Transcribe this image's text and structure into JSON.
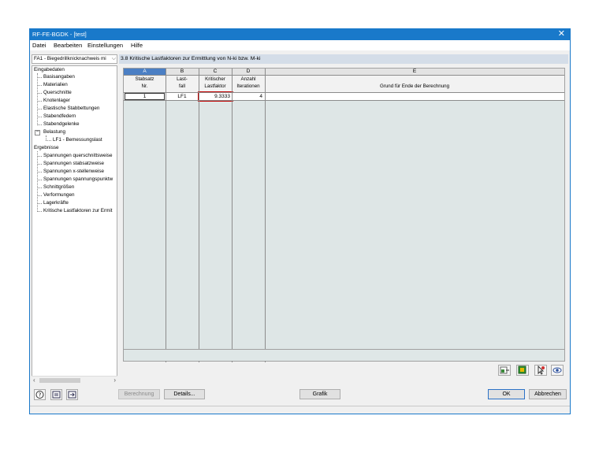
{
  "window": {
    "title": "RF-FE-BGDK - [test]",
    "close_glyph": "✕"
  },
  "menu": [
    "Datei",
    "Bearbeiten",
    "Einstellungen",
    "Hilfe"
  ],
  "case_selector": {
    "value": "FA1 - Biegedrillknicknachweis mi"
  },
  "tree": {
    "input_header": "Eingabedaten",
    "input_items": [
      "Basisangaben",
      "Materialien",
      "Querschnitte",
      "Knotenlager",
      "Elastische Stabbettungen",
      "Stabendfedern",
      "Stabendgelenke"
    ],
    "belastung": "Belastung",
    "belastung_child": "LF1 - Bemessungslast",
    "results_header": "Ergebnisse",
    "result_items": [
      "Spannungen querschnittsweise",
      "Spannungen stabsatzweise",
      "Spannungen x-stellenweise",
      "Spannungen spannungspunktw",
      "Schnittgrößen",
      "Verformungen",
      "Lagerkräfte",
      "Kritische Lastfaktoren zur Ermit"
    ]
  },
  "panel": {
    "title": "3.8 Kritische Lastfaktoren zur Ermittlung von N-ki bzw. M-ki"
  },
  "table": {
    "column_letters": [
      "A",
      "B",
      "C",
      "D",
      "E"
    ],
    "column_headers": [
      [
        "Stabsatz",
        "Nr."
      ],
      [
        "Last-",
        "fall"
      ],
      [
        "Kritischer",
        "Lastfaktor"
      ],
      [
        "Anzahl",
        "Iterationen"
      ],
      [
        "",
        "Grund für Ende der Berechnung"
      ]
    ],
    "rows": [
      {
        "stabsatz": "1",
        "lastfall": "LF1",
        "lastfaktor": "9.3333",
        "iterationen": "4",
        "grund": ""
      }
    ],
    "highlight_color": "#c00000"
  },
  "buttons": {
    "berechnung": "Berechnung",
    "details": "Details...",
    "grafik": "Grafik",
    "ok": "OK",
    "abbrechen": "Abbrechen"
  },
  "colors": {
    "titlebar": "#1979ca",
    "active_column": "#4b7fc4",
    "grid_bg": "#dee6e6"
  }
}
